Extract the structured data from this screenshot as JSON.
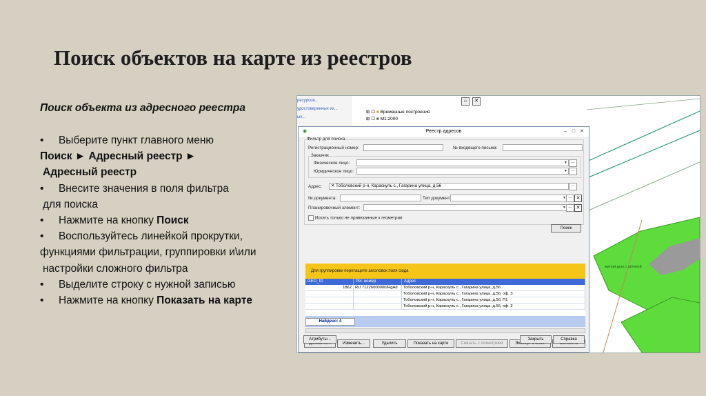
{
  "slide": {
    "title": "Поиск объектов на карте из реестров",
    "subtitle": "Поиск объекта из адресного реестра",
    "steps": [
      {
        "text": "Выберите пункт главного меню"
      },
      {
        "text": "Поиск ► Адресный реестр ►"
      },
      {
        "text": "Адресный реестр"
      },
      {
        "text": "Внесите значения в поля фильтра"
      },
      {
        "text": "для поиска"
      },
      {
        "pre": "Нажмите на кнопку ",
        "bold": "Поиск"
      },
      {
        "text": "Воспользуйтесь линейкой прокрутки,"
      },
      {
        "text": "функциями фильтрации, группировки и\\или"
      },
      {
        "text": "настройки сложного фильтра"
      },
      {
        "text": "Выделите строку с нужной записью"
      },
      {
        "pre": "Нажмите на кнопку ",
        "bold": "Показать на карте"
      }
    ]
  },
  "app": {
    "left_panel": [
      "ресурсов...",
      "удостоверенных их...",
      "ых..."
    ],
    "tree": [
      "Временные построения",
      "M1:2000"
    ],
    "map_label": "жилой дом с аптекой",
    "dialog": {
      "title": "Реестр адресов",
      "filter_group": "Фильтр для поиска",
      "reg_number_label": "Регистрационный номер:",
      "reg_number_value": "",
      "incoming_letter_label": "№ входящего письма:",
      "incoming_letter_value": "",
      "customer_group": "Заказчик",
      "person_label": "Физическое лицо:",
      "person_value": "",
      "legal_label": "Юридическое лицо:",
      "legal_value": "",
      "address_label": "Адрес:",
      "address_value": "Тоболовский р-н, Караскуль с., Гагарина улица, д.56",
      "doc_number_label": "№ документа:",
      "doc_number_value": "",
      "doc_type_label": "Тип документа:",
      "doc_type_value": "",
      "planning_label": "Планировочный элемент:",
      "planning_value": "",
      "checkbox_label": "Искать только не привязанные к геометрии",
      "search_button": "Поиск",
      "group_hint": "Для группировки перетащите заголовок поля сюда",
      "columns": [
        "GEO_ID",
        "Рег. номер",
        "Адрес"
      ],
      "rows": [
        [
          "1862",
          "RU 71226000000/RgAd",
          "Тоболовский р-н, Караскуль с., Гагарина улица, д.56"
        ],
        [
          "",
          "",
          "Тоболовский р-н, Караскуль с., Гагарина улица, д.56, оф. 3"
        ],
        [
          "",
          "",
          "Тоболовский р-н, Караскуль с., Гагарина улица, д.56, П1"
        ],
        [
          "",
          "",
          "Тоболовский р-н, Караскуль с., Гагарина улица, д.56, оф. 2"
        ]
      ],
      "found": "Найдено: 4",
      "buttons": [
        "Добавить...",
        "Изменить...",
        "Удалить",
        "Показать на карте",
        "Связать с геометрией",
        "Экспорт в Excel",
        "Обновить"
      ],
      "attr_button": "Атрибуты...",
      "close_button": "Закрыть",
      "help_button": "Справка"
    }
  }
}
